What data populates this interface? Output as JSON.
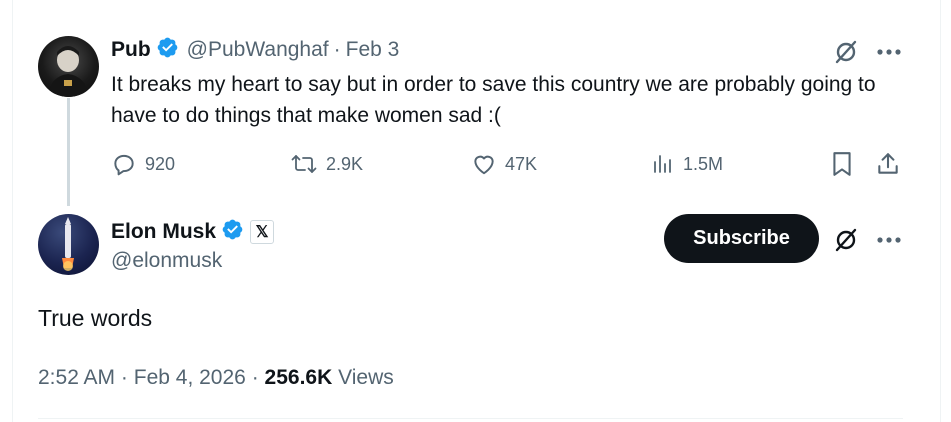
{
  "quoted_tweet": {
    "author_name": "Pub",
    "author_handle": "@PubWanghaf",
    "separator": "·",
    "date": "Feb 3",
    "text": "It breaks my heart to say but in order to save this country we are probably going to have to do things that make women sad :(",
    "stats": {
      "replies": "920",
      "reposts": "2.9K",
      "likes": "47K",
      "views": "1.5M"
    },
    "icons": {
      "grok": "slashed-circle-icon",
      "more": "more-dots-icon",
      "reply": "reply-bubble-icon",
      "repost": "repost-arrows-icon",
      "like": "heart-icon",
      "views": "bar-chart-icon",
      "bookmark": "bookmark-icon",
      "share": "share-upload-icon"
    }
  },
  "main_tweet": {
    "author_name": "Elon Musk",
    "author_handle": "@elonmusk",
    "badge": "𝕏",
    "subscribe_label": "Subscribe",
    "text": "True words",
    "time": "2:52 AM",
    "separator": "·",
    "date": "Feb 4, 2026",
    "separator2": "·",
    "views_count": "256.6K",
    "views_label": "Views"
  },
  "colors": {
    "verified_blue": "#1d9bf0",
    "text_primary": "#0f1419",
    "text_secondary": "#536471",
    "button_dark": "#0f1419"
  }
}
